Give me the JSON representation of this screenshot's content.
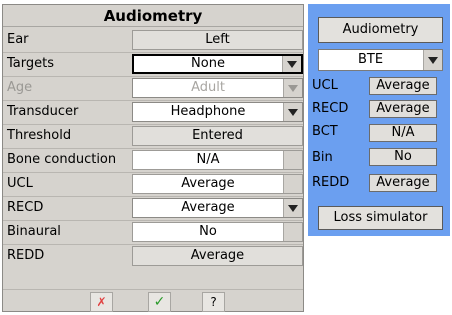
{
  "panel": {
    "title": "Audiometry",
    "rows": [
      {
        "label": "Ear",
        "value": "Left"
      },
      {
        "label": "Targets",
        "value": "None"
      },
      {
        "label": "Age",
        "value": "Adult"
      },
      {
        "label": "Transducer",
        "value": "Headphone"
      },
      {
        "label": "Threshold",
        "value": "Entered"
      },
      {
        "label": "Bone conduction",
        "value": "N/A"
      },
      {
        "label": "UCL",
        "value": "Average"
      },
      {
        "label": "RECD",
        "value": "Average"
      },
      {
        "label": "Binaural",
        "value": "No"
      },
      {
        "label": "REDD",
        "value": "Average"
      }
    ],
    "buttons": {
      "cancel": "✗",
      "ok": "✓",
      "help": "?"
    }
  },
  "side": {
    "audiometry_button": "Audiometry",
    "style_value": "BTE",
    "rows": [
      {
        "label": "UCL",
        "value": "Average"
      },
      {
        "label": "RECD",
        "value": "Average"
      },
      {
        "label": "BCT",
        "value": "N/A"
      },
      {
        "label": "Bin",
        "value": "No"
      },
      {
        "label": "REDD",
        "value": "Average"
      }
    ],
    "loss_simulator_button": "Loss simulator"
  },
  "colors": {
    "panel_bg": "#d6d3ce",
    "side_bg": "#6b9ff0",
    "cancel": "#e04040",
    "ok": "#2a9a2a"
  }
}
